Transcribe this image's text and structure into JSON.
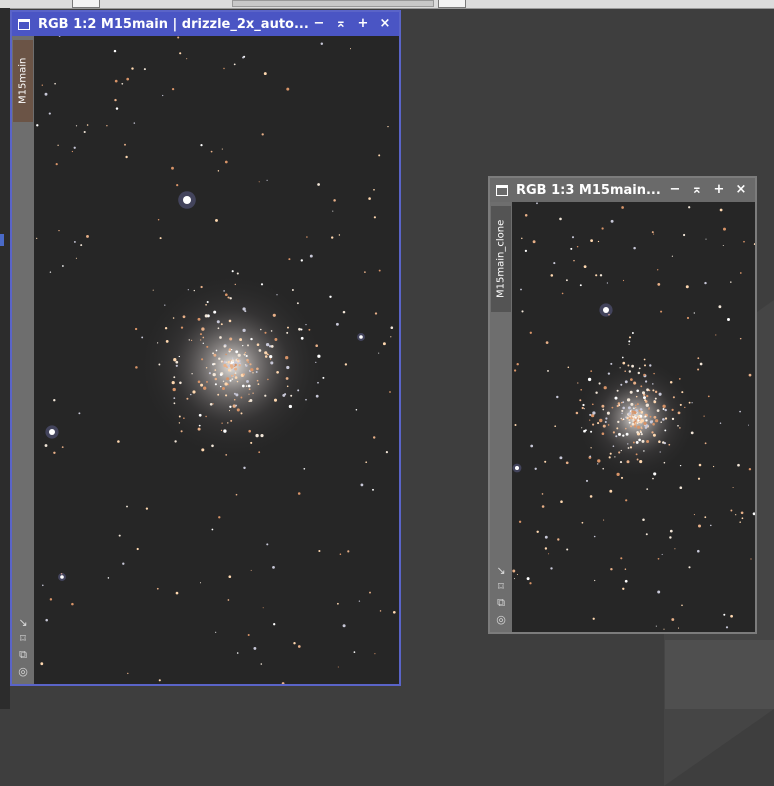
{
  "windows": [
    {
      "title": "RGB 1:2 M15main | drizzle_2x_auto...",
      "tab_label": "M15main",
      "buttons": [
        "−",
        "⌅",
        "+",
        "×"
      ]
    },
    {
      "title": "RGB 1:3 M15main...",
      "tab_label": "M15main_clone",
      "buttons": [
        "−",
        "⌅",
        "+",
        "×"
      ]
    }
  ],
  "side_icons": [
    "↘",
    "⌑",
    "⧉",
    "◎"
  ],
  "colors": {
    "active_titlebar": "#4a55c4",
    "inactive_titlebar": "#6a6a6a",
    "image_background": "#262626"
  }
}
